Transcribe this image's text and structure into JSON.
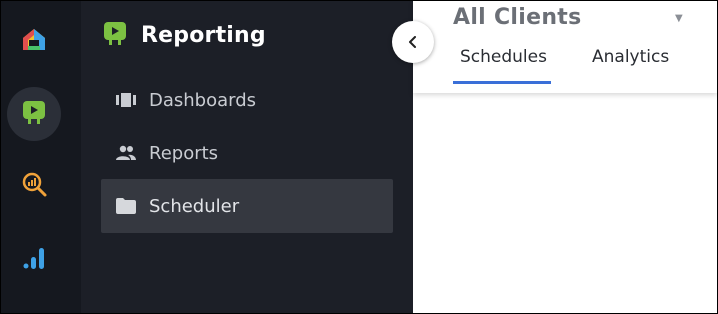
{
  "sidebar": {
    "title": "Reporting",
    "items": [
      {
        "label": "Dashboards",
        "icon": "dashboard-icon"
      },
      {
        "label": "Reports",
        "icon": "people-icon"
      },
      {
        "label": "Scheduler",
        "icon": "folder-icon",
        "active": true
      }
    ]
  },
  "rail": {
    "items": [
      {
        "icon": "home-logo-icon"
      },
      {
        "icon": "reporting-app-icon",
        "active": true
      },
      {
        "icon": "analytics-search-icon"
      },
      {
        "icon": "signal-bars-icon"
      }
    ]
  },
  "header": {
    "client_selector": "All Clients",
    "tabs": [
      {
        "label": "Schedules",
        "active": true
      },
      {
        "label": "Analytics"
      }
    ]
  },
  "colors": {
    "rail_bg": "#15181f",
    "sidebar_bg": "#1c1f27",
    "active_item_bg": "#353840",
    "brand_green": "#7cc142",
    "tab_accent": "#3a6fd8"
  }
}
